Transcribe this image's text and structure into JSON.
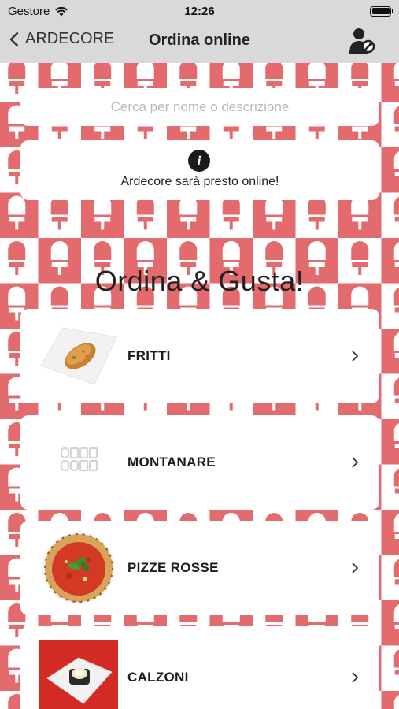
{
  "status_bar": {
    "carrier": "Gestore",
    "time": "12:26"
  },
  "nav": {
    "back_label": "ARDECORE",
    "title": "Ordina online"
  },
  "search": {
    "placeholder": "Cerca per nome o descrizione"
  },
  "info": {
    "message": "Ardecore sarà presto online!"
  },
  "headline": "Ordina & Gusta!",
  "categories": [
    {
      "label": "FRITTI",
      "thumb": "fried-croquette-plate"
    },
    {
      "label": "MONTANARE",
      "thumb": "ardecore-logo"
    },
    {
      "label": "PIZZE ROSSE",
      "thumb": "pizza-marinara"
    },
    {
      "label": "CALZONI",
      "thumb": "calzone-plate"
    }
  ],
  "colors": {
    "pattern_red": "#e36a6d",
    "nav_bg": "#d9d9d9"
  }
}
